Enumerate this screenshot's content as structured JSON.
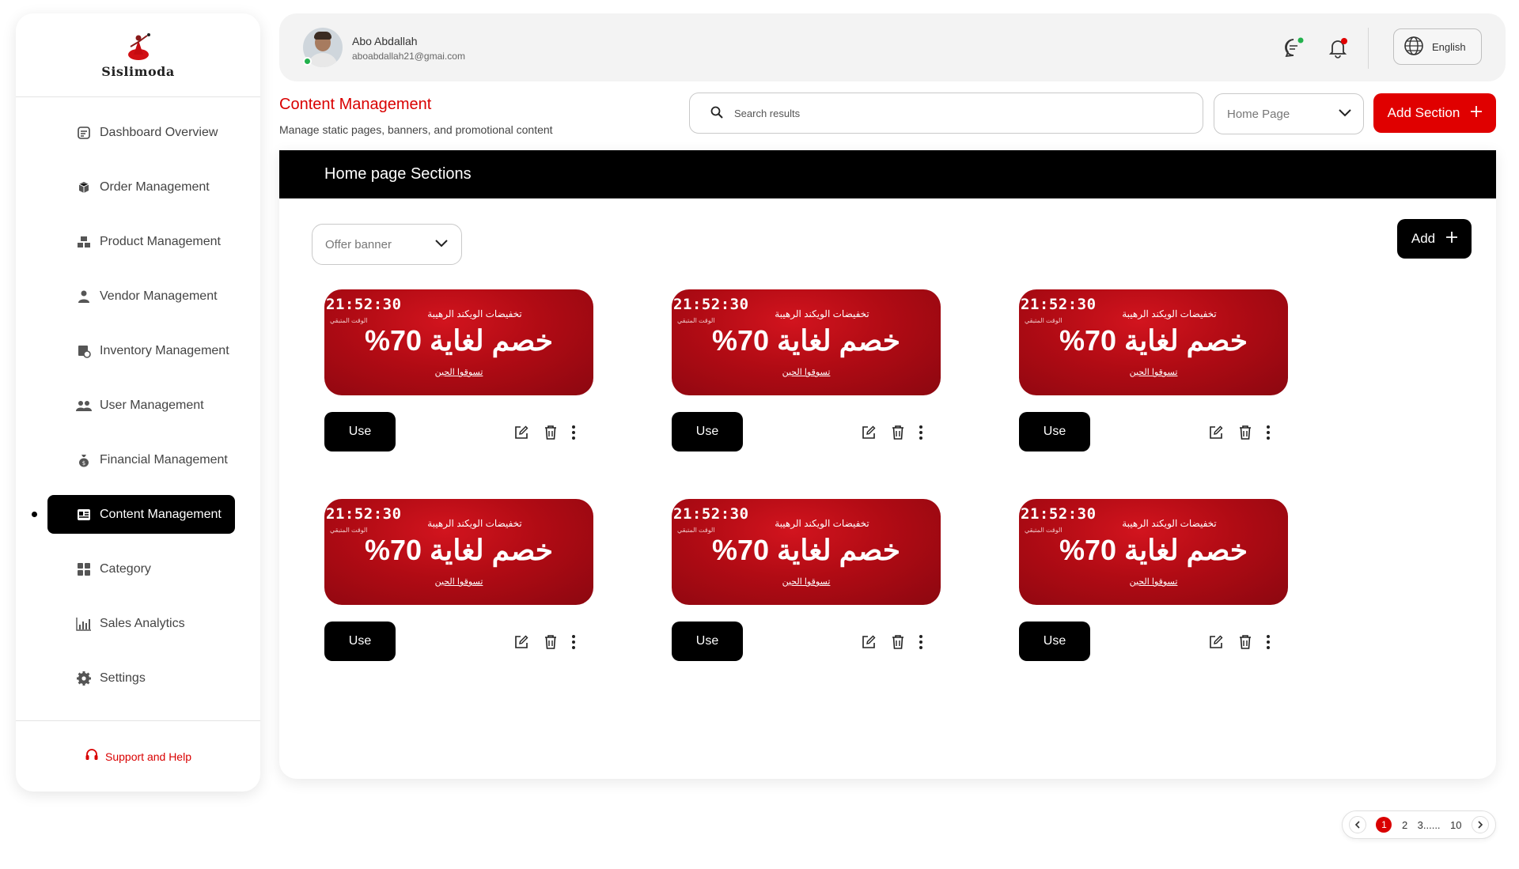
{
  "brand": {
    "name": "Sislimoda",
    "accent": "#d90000"
  },
  "sidebar": {
    "items": [
      {
        "label": "Dashboard Overview",
        "icon": "dashboard-icon"
      },
      {
        "label": "Order Management",
        "icon": "orders-icon"
      },
      {
        "label": "Product Management",
        "icon": "products-icon"
      },
      {
        "label": "Vendor Management",
        "icon": "vendor-icon"
      },
      {
        "label": "Inventory Management",
        "icon": "inventory-icon"
      },
      {
        "label": "User Management",
        "icon": "users-icon"
      },
      {
        "label": "Financial Management",
        "icon": "money-bag-icon"
      },
      {
        "label": "Content Management",
        "icon": "content-icon",
        "active": true
      },
      {
        "label": "Category",
        "icon": "category-grid-icon"
      },
      {
        "label": "Sales Analytics",
        "icon": "analytics-icon"
      },
      {
        "label": "Settings",
        "icon": "gear-icon"
      }
    ],
    "support_label": "Support and Help"
  },
  "header": {
    "user_name": "Abo Abdallah",
    "user_email": "aboabdallah21@gmai.com",
    "language": "English"
  },
  "page": {
    "title": "Content Management",
    "subtitle": "Manage static pages, banners, and promotional content",
    "search_placeholder": "Search results",
    "page_select": "Home Page",
    "add_section_label": "Add Section"
  },
  "panel": {
    "title": "Home page Sections",
    "filter_value": "Offer banner",
    "add_label": "Add"
  },
  "banner": {
    "timer": "21:52:30",
    "timer_label": "الوقت المتبقي",
    "headline": "تخفيضات الويكند الرهيبة",
    "big_text": "خصم لغاية 70%",
    "cta": "تسوقوا الحين"
  },
  "cards": [
    {
      "use_label": "Use"
    },
    {
      "use_label": "Use"
    },
    {
      "use_label": "Use"
    },
    {
      "use_label": "Use"
    },
    {
      "use_label": "Use"
    },
    {
      "use_label": "Use"
    }
  ],
  "pagination": {
    "current": "1",
    "pages": [
      "2",
      "3......",
      "10"
    ]
  }
}
